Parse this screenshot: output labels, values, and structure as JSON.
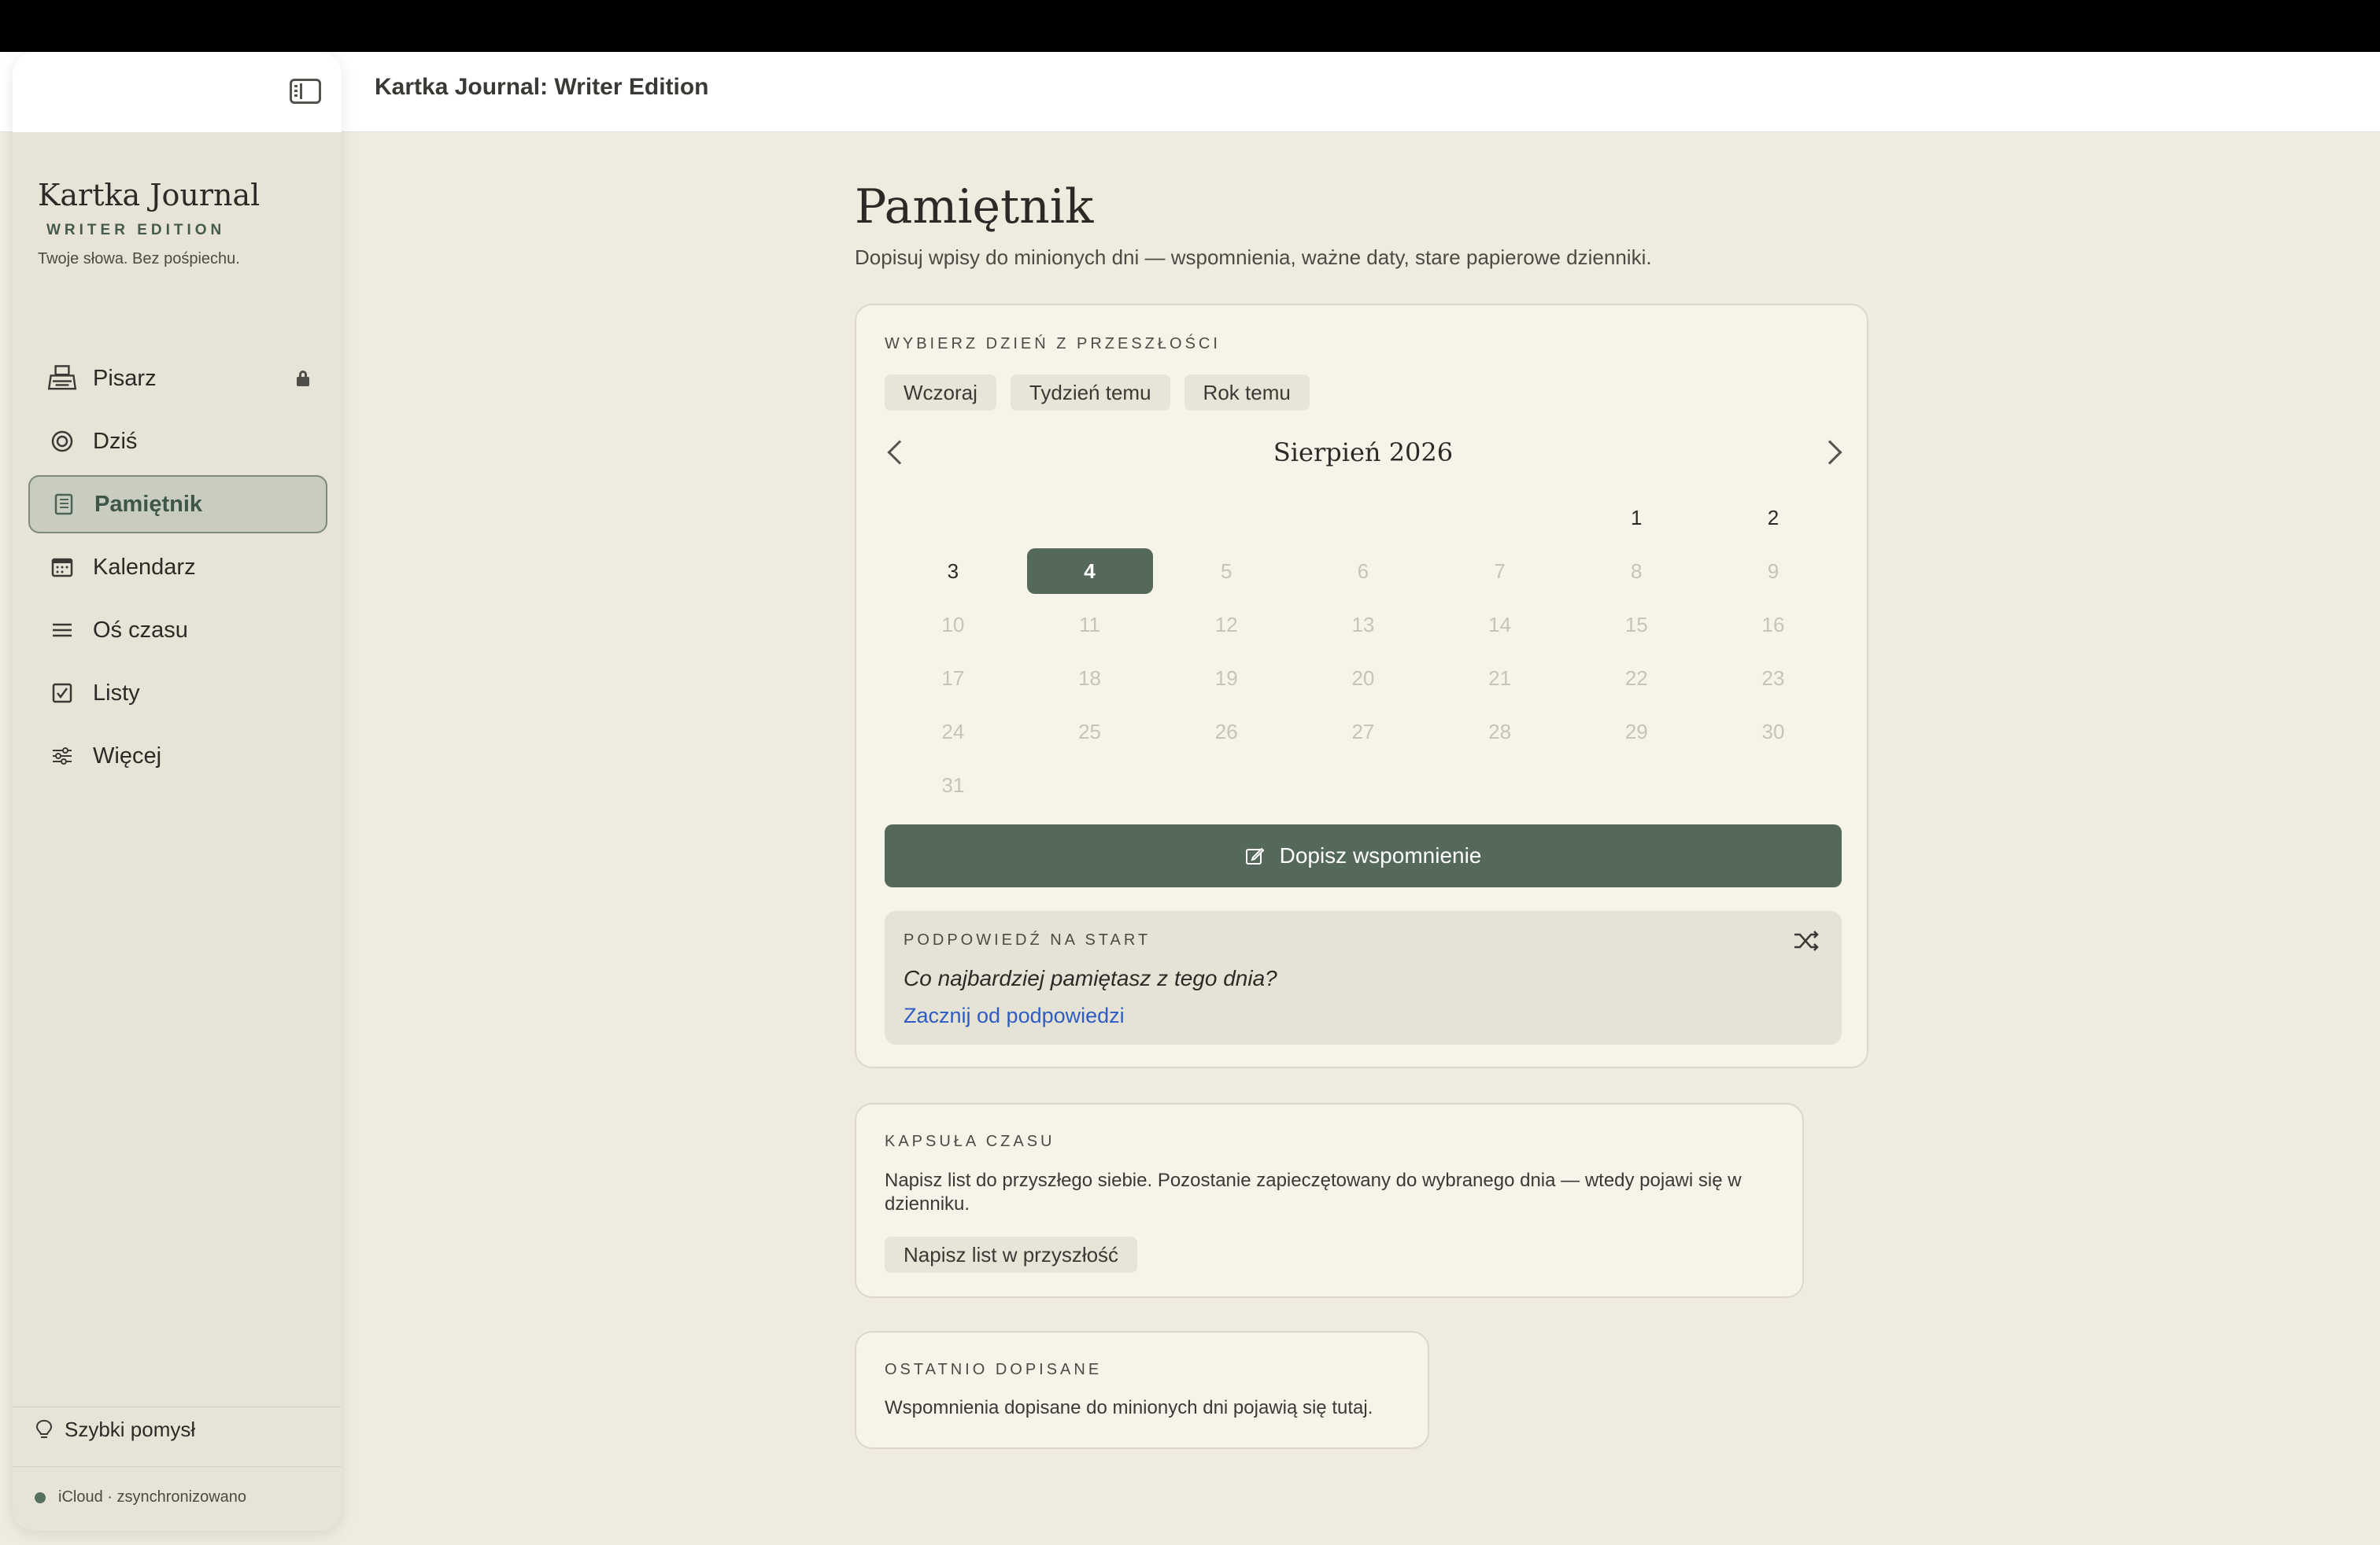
{
  "app": {
    "window_title": "Kartka Journal: Writer Edition"
  },
  "sidebar": {
    "brand_title": "Kartka Journal",
    "brand_subtitle": "WRITER EDITION",
    "brand_tagline": "Twoje słowa. Bez pośpiechu.",
    "items": [
      {
        "label": "Pisarz",
        "icon": "typewriter-icon",
        "locked": true
      },
      {
        "label": "Dziś",
        "icon": "target-icon"
      },
      {
        "label": "Pamiętnik",
        "icon": "notebook-icon",
        "active": true
      },
      {
        "label": "Kalendarz",
        "icon": "calendar-icon"
      },
      {
        "label": "Oś czasu",
        "icon": "lines-icon"
      },
      {
        "label": "Listy",
        "icon": "checkbox-icon"
      },
      {
        "label": "Więcej",
        "icon": "sliders-icon"
      }
    ],
    "quick_idea": "Szybki pomysł",
    "sync_status": "iCloud · zsynchronizowano"
  },
  "main": {
    "title": "Pamiętnik",
    "description": "Dopisuj wpisy do minionych dni — wspomnienia, ważne daty, stare papierowe dzienniki.",
    "past": {
      "label": "WYBIERZ DZIEŃ Z PRZESZŁOŚCI",
      "chips": [
        "Wczoraj",
        "Tydzień temu",
        "Rok temu"
      ],
      "month": "Sierpień 2026",
      "weeks": [
        [
          "",
          "",
          "",
          "",
          "",
          "1",
          "2"
        ],
        [
          "3",
          "4",
          "5",
          "6",
          "7",
          "8",
          "9"
        ],
        [
          "10",
          "11",
          "12",
          "13",
          "14",
          "15",
          "16"
        ],
        [
          "17",
          "18",
          "19",
          "20",
          "21",
          "22",
          "23"
        ],
        [
          "24",
          "25",
          "26",
          "27",
          "28",
          "29",
          "30"
        ],
        [
          "31",
          "",
          "",
          "",
          "",
          "",
          ""
        ]
      ],
      "selected_day": "4",
      "enabled_days": [
        "1",
        "2",
        "3",
        "4"
      ],
      "cta": "Dopisz wspomnienie",
      "hint_label": "PODPOWIEDŹ NA START",
      "hint_question": "Co najbardziej pamiętasz z tego dnia?",
      "hint_link": "Zacznij od podpowiedzi"
    },
    "capsule": {
      "label": "KAPSUŁA CZASU",
      "text": "Napisz list do przyszłego siebie. Pozostanie zapieczętowany do wybranego dnia — wtedy pojawi się w dzienniku.",
      "button": "Napisz list w przyszłość"
    },
    "recent": {
      "label": "OSTATNIO DOPISANE",
      "text": "Wspomnienia dopisane do minionych dni pojawią się tutaj."
    }
  },
  "colors": {
    "accent": "#55695b",
    "background": "#efebdf",
    "card": "#f6f3e9",
    "link": "#2f5cc2"
  }
}
